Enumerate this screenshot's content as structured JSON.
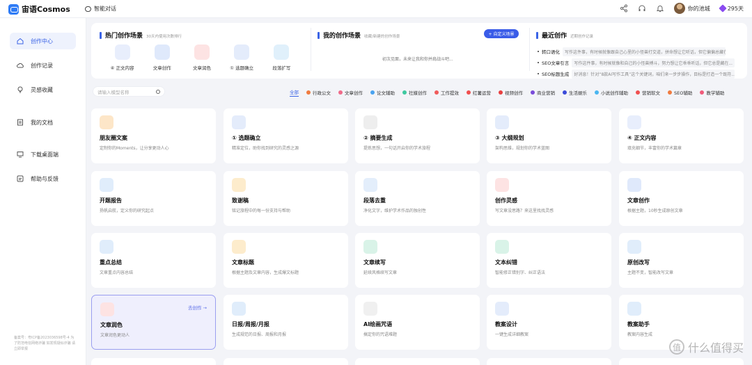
{
  "app": {
    "logo": "宙语Cosmos",
    "nav_chat": "智能对话"
  },
  "user": {
    "name": "你的池城",
    "points": "295天"
  },
  "sidebar": {
    "items": [
      {
        "label": "创作中心",
        "icon": "home-icon"
      },
      {
        "label": "创作记录",
        "icon": "cloud-icon"
      },
      {
        "label": "灵感收藏",
        "icon": "bulb-icon"
      },
      {
        "label": "我的文档",
        "icon": "document-icon"
      },
      {
        "label": "下载桌面端",
        "icon": "monitor-icon"
      },
      {
        "label": "帮助与反馈",
        "icon": "help-icon"
      }
    ],
    "footer": "备案号：粤ICP备2023036598号-4 为了防范电信网络诈骗 如发现疑似诈骗 请立即举报"
  },
  "hot": {
    "title": "热门创作场景",
    "subtitle": "30天内使用次数排行",
    "items": [
      {
        "label": "④ 正文内容",
        "color": "#e8eefc"
      },
      {
        "label": "文章创作",
        "color": "#dfe9fb"
      },
      {
        "label": "文章润色",
        "color": "#fde3e3"
      },
      {
        "label": "① 选题确立",
        "color": "#e4ecfb"
      },
      {
        "label": "段落扩写",
        "color": "#e0f0fb"
      }
    ]
  },
  "mine": {
    "title": "我的创作场景",
    "subtitle": "收藏/新建的创作场景",
    "custom_button": "+ 自定义场景",
    "empty_text": "初次见面，未来让我和你并肩战斗吧..."
  },
  "recent": {
    "title": "最近创作",
    "subtitle": "近期创作记录",
    "items": [
      {
        "key": "转口语化",
        "text": "写作这件事，有时候就像跟自己心里的小怪兽打交道，拼命想让它听话，但它偏偏总藏在..."
      },
      {
        "key": "SEO文章引言",
        "text": "写作这件事，有时候就像和自己的小怪兽搏斗，努力想让它乖乖听话，但它总是藏在..."
      },
      {
        "key": "SEO标题生成",
        "text": "好消息！针对“8款AI写作工具”这个关键词，咱们来一步步操作，目标是打造一个既符..."
      }
    ]
  },
  "search": {
    "placeholder": "请输入模型名称"
  },
  "filters": [
    {
      "label": "全部",
      "color": ""
    },
    {
      "label": "行政公文",
      "color": "#f07b3f"
    },
    {
      "label": "文章创作",
      "color": "#f06b8a"
    },
    {
      "label": "论文辅助",
      "color": "#4aa3f0"
    },
    {
      "label": "社媒创作",
      "color": "#3ec9a0"
    },
    {
      "label": "工作提效",
      "color": "#f05b5b"
    },
    {
      "label": "红薯运营",
      "color": "#f04e4e"
    },
    {
      "label": "视频创作",
      "color": "#e84040"
    },
    {
      "label": "商业营销",
      "color": "#7a4bd9"
    },
    {
      "label": "生活娱乐",
      "color": "#3a4ad9"
    },
    {
      "label": "小说创作辅助",
      "color": "#4ab6f0"
    },
    {
      "label": "营销软文",
      "color": "#f05050"
    },
    {
      "label": "SEO辅助",
      "color": "#f07b3f"
    },
    {
      "label": "教学辅助",
      "color": "#f05b7b"
    }
  ],
  "cards": [
    {
      "title": "朋友圈文案",
      "desc": "定制你的Moments，让分享更动人心",
      "color": "#fde6c8"
    },
    {
      "title": "① 选题确立",
      "desc": "精准定位，助你找到研究的灵感之源",
      "color": "#e4ecfb"
    },
    {
      "title": "② 摘要生成",
      "desc": "提炼思想，一句话开启你的学术旅程",
      "color": "#eeeeee"
    },
    {
      "title": "③ 大纲规划",
      "desc": "架构思维，规划你的学术蓝图",
      "color": "#e4ecfb"
    },
    {
      "title": "④ 正文内容",
      "desc": "填充细节，丰富你的学术篇章",
      "color": "#e8eefc"
    },
    {
      "title": "开题报告",
      "desc": "扬帆启航，定义你的研究起点",
      "color": "#e0edfb"
    },
    {
      "title": "致谢稿",
      "desc": "铭记旅程中的每一份支持与帮助",
      "color": "#fdeccc"
    },
    {
      "title": "段落去重",
      "desc": "净化文字，维护学术作品的独创性",
      "color": "#e3eefb"
    },
    {
      "title": "创作灵感",
      "desc": "写文章没思路？来这里找找灵感",
      "color": "#fde3e3"
    },
    {
      "title": "文章创作",
      "desc": "根据主题，10秒生成原创文章",
      "color": "#dfe9fb"
    },
    {
      "title": "重点总结",
      "desc": "文章重点内容总结",
      "color": "#e0edfb"
    },
    {
      "title": "文章标题",
      "desc": "根据主题及文章内容，生成爆文标题",
      "color": "#fdeccc"
    },
    {
      "title": "文章续写",
      "desc": "延续风格续写文章",
      "color": "#d9f3e8"
    },
    {
      "title": "文本纠错",
      "desc": "智能修正错别字、纠正语法",
      "color": "#d9f3e8"
    },
    {
      "title": "原创改写",
      "desc": "主题不变，智能改写文章",
      "color": "#e0edfb"
    },
    {
      "title": "文章润色",
      "desc": "文章润色更动人",
      "color": "#fde3e3",
      "action": "去创作 →"
    },
    {
      "title": "日报/周报/月报",
      "desc": "生成规范的日报、周报和月报",
      "color": "#e0edfb"
    },
    {
      "title": "AI绘画咒语",
      "desc": "搞定你的咒语难题",
      "color": "#f0f0f0"
    },
    {
      "title": "教案设计",
      "desc": "一键生成详细教案",
      "color": "#e4ecfb"
    },
    {
      "title": "教案助手",
      "desc": "教案内容生成",
      "color": "#e0edfb"
    }
  ],
  "watermark": "什么值得买"
}
